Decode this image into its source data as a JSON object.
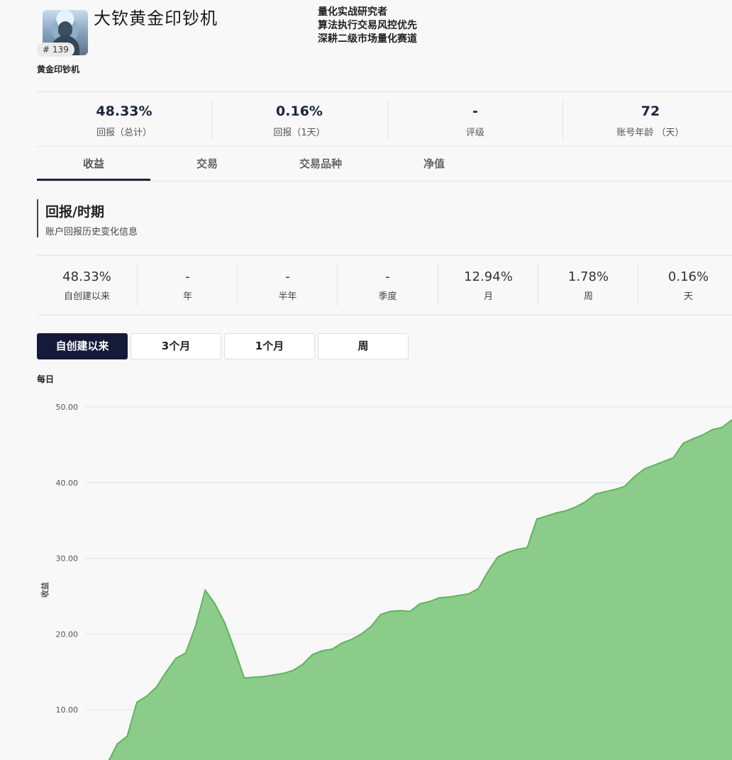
{
  "profile": {
    "title": "大钦黄金印钞机",
    "rank": "# 139",
    "display_name": "黄金印钞机",
    "bio": [
      "量化实战研究者",
      "算法执行交易风控优先",
      "深耕二级市场量化赛道"
    ]
  },
  "stats": [
    {
      "value": "48.33%",
      "label": "回报（总计）"
    },
    {
      "value": "0.16%",
      "label": "回报（1天）"
    },
    {
      "value": "-",
      "label": "评级"
    },
    {
      "value": "72",
      "label": "账号年龄 （天）"
    }
  ],
  "tabs": [
    {
      "label": "收益",
      "active": true
    },
    {
      "label": "交易",
      "active": false
    },
    {
      "label": "交易品种",
      "active": false
    },
    {
      "label": "净值",
      "active": false
    }
  ],
  "section": {
    "title": "回报/时期",
    "subtitle": "账户回报历史变化信息"
  },
  "period_returns": [
    {
      "value": "48.33%",
      "label": "自创建以来"
    },
    {
      "value": "-",
      "label": "年"
    },
    {
      "value": "-",
      "label": "半年"
    },
    {
      "value": "-",
      "label": "季度"
    },
    {
      "value": "12.94%",
      "label": "月"
    },
    {
      "value": "1.78%",
      "label": "周"
    },
    {
      "value": "0.16%",
      "label": "天"
    }
  ],
  "range_buttons": [
    {
      "label": "自创建以来",
      "active": true
    },
    {
      "label": "3个月",
      "active": false
    },
    {
      "label": "1个月",
      "active": false
    },
    {
      "label": "周",
      "active": false
    }
  ],
  "frequency_label": "每日",
  "colors": {
    "accent": "#1c2440",
    "area_fill": "#8ccc8a",
    "area_line": "#5fb35c"
  },
  "chart_data": {
    "type": "area",
    "ylabel": "收益",
    "y_ticks": [
      "50.00",
      "40.00",
      "30.00",
      "20.00",
      "10.00"
    ],
    "ylim": [
      0,
      50
    ],
    "grid": true,
    "legend": "none",
    "values": [
      0.0,
      3.0,
      5.5,
      6.5,
      11.0,
      11.8,
      13.0,
      15.0,
      16.8,
      17.5,
      21.0,
      25.8,
      24.0,
      21.5,
      18.0,
      14.2,
      14.3,
      14.4,
      14.6,
      14.8,
      15.2,
      16.0,
      17.3,
      17.8,
      18.0,
      18.8,
      19.3,
      20.0,
      21.0,
      22.6,
      23.0,
      23.1,
      23.0,
      24.0,
      24.3,
      24.8,
      24.9,
      25.1,
      25.3,
      26.0,
      28.3,
      30.2,
      30.8,
      31.2,
      31.4,
      35.2,
      35.6,
      36.0,
      36.3,
      36.8,
      37.5,
      38.5,
      38.8,
      39.1,
      39.5,
      40.8,
      41.8,
      42.3,
      42.8,
      43.3,
      45.2,
      45.8,
      46.3,
      47.0,
      47.3,
      48.3
    ]
  }
}
